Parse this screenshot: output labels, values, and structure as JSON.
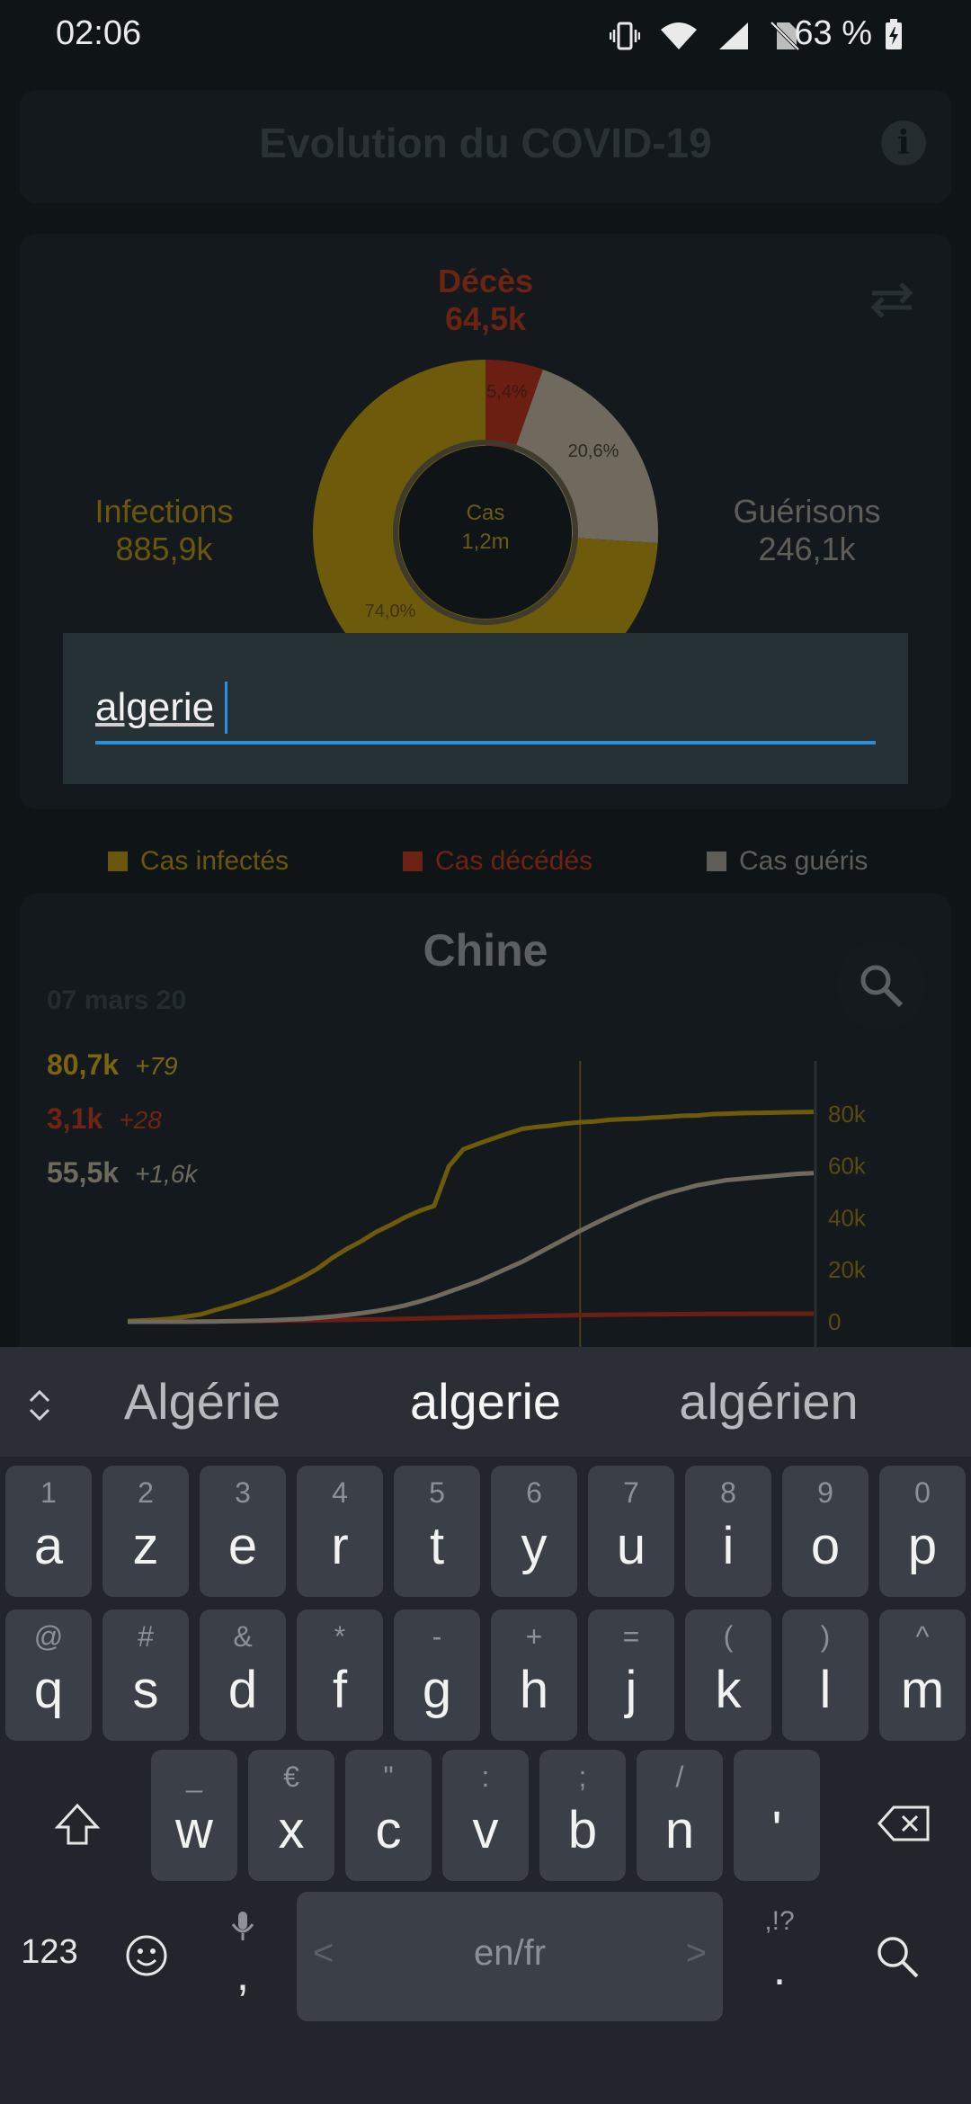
{
  "status_bar": {
    "time": "02:06",
    "battery": "63 %"
  },
  "app": {
    "title": "Evolution du COVID-19",
    "info_icon": "info-icon"
  },
  "donut": {
    "deaths_label": "Décès",
    "deaths_value": "64,5k",
    "infections_label": "Infections",
    "infections_value": "885,9k",
    "recoveries_label": "Guérisons",
    "recoveries_value": "246,1k",
    "center_label": "Cas",
    "center_value": "1,2m",
    "pct_deaths": "5,4%",
    "pct_recovered": "20,6%",
    "pct_infected": "74,0%",
    "colors": {
      "infected": "#6e5a0b",
      "deaths": "#6b1f12",
      "recovered": "#6f6a5d"
    },
    "fractions": {
      "deaths": 0.054,
      "recovered": 0.206,
      "infected": 0.74
    }
  },
  "search_dialog": {
    "value": "algerie"
  },
  "legend": {
    "infected": "Cas infectés",
    "deaths": "Cas décédés",
    "recovered": "Cas guéris"
  },
  "country_card": {
    "country": "Chine",
    "date": "07 mars 20",
    "stats": [
      {
        "value": "80,7k",
        "delta": "+79",
        "color": "#7a6414"
      },
      {
        "value": "3,1k",
        "delta": "+28",
        "color": "#6f2414"
      },
      {
        "value": "55,5k",
        "delta": "+1,6k",
        "color": "#6e6a5e"
      }
    ],
    "chart_data": {
      "type": "line",
      "yticks": [
        "80k",
        "60k",
        "40k",
        "20k",
        "0"
      ],
      "ylim": [
        0,
        90000
      ],
      "x": [
        0,
        1,
        2,
        3,
        4,
        5,
        6,
        7,
        8,
        9,
        10,
        11,
        12,
        13,
        14,
        15,
        16,
        17,
        18,
        19,
        20,
        21,
        22,
        23,
        24,
        25,
        26,
        27,
        28,
        29,
        30,
        31,
        32,
        33,
        34,
        35,
        36,
        37,
        38,
        39,
        40,
        41,
        42,
        43,
        44,
        45,
        46,
        47
      ],
      "series": [
        {
          "name": "Cas infectés",
          "color": "#6e5a0b",
          "values": [
            300,
            500,
            800,
            1200,
            2000,
            2800,
            4500,
            6000,
            7800,
            9800,
            11800,
            14400,
            17200,
            20400,
            24500,
            28000,
            31000,
            34500,
            37200,
            40200,
            42700,
            44600,
            59800,
            66400,
            68500,
            70500,
            72400,
            74200,
            75000,
            75500,
            76300,
            76800,
            77100,
            77700,
            78000,
            78200,
            78600,
            78900,
            79300,
            79400,
            79900,
            80100,
            80300,
            80400,
            80500,
            80600,
            80700,
            80800
          ]
        },
        {
          "name": "Cas décédés",
          "color": "#6b1f12",
          "values": [
            10,
            20,
            40,
            60,
            90,
            130,
            170,
            210,
            260,
            300,
            360,
            430,
            490,
            560,
            640,
            720,
            810,
            910,
            1010,
            1110,
            1260,
            1380,
            1520,
            1670,
            1770,
            1870,
            2010,
            2120,
            2240,
            2340,
            2440,
            2590,
            2660,
            2710,
            2760,
            2830,
            2870,
            2910,
            2940,
            2980,
            3010,
            3040,
            3050,
            3070,
            3080,
            3100,
            3110,
            3120
          ]
        },
        {
          "name": "Cas guéris",
          "color": "#6f6a5d",
          "values": [
            0,
            0,
            0,
            0,
            0,
            50,
            100,
            200,
            300,
            450,
            600,
            850,
            1100,
            1500,
            2000,
            2600,
            3300,
            4100,
            5100,
            6300,
            7800,
            9500,
            11500,
            13500,
            15500,
            18000,
            20500,
            23000,
            26000,
            29000,
            32000,
            35000,
            37800,
            40500,
            43000,
            45500,
            47700,
            49500,
            51000,
            52500,
            53500,
            54500,
            55000,
            55500,
            56000,
            56500,
            57000,
            57200
          ]
        }
      ],
      "cursor_index": 31
    }
  },
  "keyboard": {
    "suggestions": [
      "Algérie",
      "algerie",
      "algérien"
    ],
    "row1": [
      [
        "1",
        "a"
      ],
      [
        "2",
        "z"
      ],
      [
        "3",
        "e"
      ],
      [
        "4",
        "r"
      ],
      [
        "5",
        "t"
      ],
      [
        "6",
        "y"
      ],
      [
        "7",
        "u"
      ],
      [
        "8",
        "i"
      ],
      [
        "9",
        "o"
      ],
      [
        "0",
        "p"
      ]
    ],
    "row2": [
      [
        "@",
        "q"
      ],
      [
        "#",
        "s"
      ],
      [
        "&",
        "d"
      ],
      [
        "*",
        "f"
      ],
      [
        "-",
        "g"
      ],
      [
        "+",
        "h"
      ],
      [
        "=",
        "j"
      ],
      [
        "(",
        "k"
      ],
      [
        ")",
        "l"
      ],
      [
        "^",
        "m"
      ]
    ],
    "row3": [
      [
        "_",
        "w"
      ],
      [
        "€",
        "x"
      ],
      [
        "\"",
        "c"
      ],
      [
        ":",
        "v"
      ],
      [
        ";",
        "b"
      ],
      [
        "/",
        "n"
      ],
      [
        "",
        "'"
      ]
    ],
    "symbols_key": "123",
    "space_label": "en/fr",
    "comma": ",",
    "period": ".",
    "punct_hint": ",!?"
  }
}
